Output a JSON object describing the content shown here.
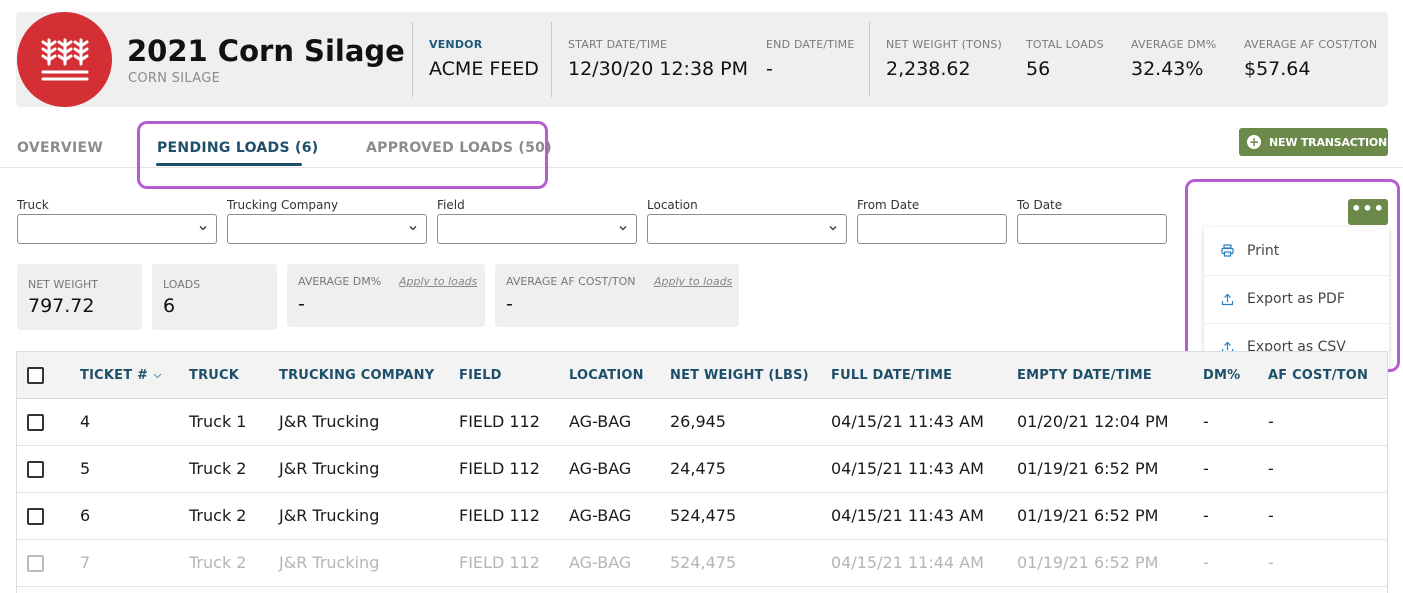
{
  "header": {
    "title": "2021 Corn Silage",
    "subtitle": "CORN SILAGE",
    "logo_icon": "wheat-icon",
    "brand_color": "#d32f34",
    "stats": {
      "vendor": {
        "label": "VENDOR",
        "value": "ACME FEED"
      },
      "start": {
        "label": "START DATE/TIME",
        "value": "12/30/20 12:38 PM"
      },
      "end": {
        "label": "END DATE/TIME",
        "value": "-"
      },
      "net_weight": {
        "label": "NET WEIGHT (TONS)",
        "value": "2,238.62"
      },
      "total_loads": {
        "label": "TOTAL LOADS",
        "value": "56"
      },
      "avg_dm": {
        "label": "AVERAGE DM%",
        "value": "32.43%"
      },
      "avg_af_cost": {
        "label": "AVERAGE AF COST/TON",
        "value": "$57.64"
      }
    }
  },
  "tabs": {
    "overview": "OVERVIEW",
    "pending": "PENDING LOADS (6)",
    "approved": "APPROVED LOADS (50)",
    "active": "pending"
  },
  "actions": {
    "new_transaction": "NEW TRANSACTION",
    "more": "•••",
    "accent_color": "#6b8a4a"
  },
  "filters": {
    "truck": {
      "label": "Truck",
      "value": ""
    },
    "trucking_company": {
      "label": "Trucking Company",
      "value": ""
    },
    "field": {
      "label": "Field",
      "value": ""
    },
    "location": {
      "label": "Location",
      "value": ""
    },
    "from_date": {
      "label": "From Date",
      "value": ""
    },
    "to_date": {
      "label": "To Date",
      "value": ""
    }
  },
  "menu": {
    "print": "Print",
    "export_pdf": "Export as PDF",
    "export_csv": "Export as CSV"
  },
  "summary": {
    "net_weight": {
      "label": "NET WEIGHT",
      "value": "797.72"
    },
    "loads": {
      "label": "LOADS",
      "value": "6"
    },
    "avg_dm": {
      "label": "AVERAGE DM%",
      "value": "-",
      "apply": "Apply to loads"
    },
    "avg_af_cost": {
      "label": "AVERAGE AF COST/TON",
      "value": "-",
      "apply": "Apply to loads"
    }
  },
  "table": {
    "columns": {
      "ticket": "TICKET #",
      "truck": "TRUCK",
      "company": "TRUCKING COMPANY",
      "field": "FIELD",
      "location": "LOCATION",
      "net_weight": "NET WEIGHT (LBS)",
      "full_date": "FULL DATE/TIME",
      "empty_date": "EMPTY DATE/TIME",
      "dm": "DM%",
      "af_cost": "AF COST/TON"
    },
    "rows": [
      {
        "ticket": "4",
        "truck": "Truck 1",
        "company": "J&R Trucking",
        "field": "FIELD 112",
        "location": "AG-BAG",
        "net_weight": "26,945",
        "full_date": "04/15/21 11:43 AM",
        "empty_date": "01/20/21 12:04 PM",
        "dm": "-",
        "af_cost": "-"
      },
      {
        "ticket": "5",
        "truck": "Truck 2",
        "company": "J&R Trucking",
        "field": "FIELD 112",
        "location": "AG-BAG",
        "net_weight": "24,475",
        "full_date": "04/15/21 11:43 AM",
        "empty_date": "01/19/21 6:52 PM",
        "dm": "-",
        "af_cost": "-"
      },
      {
        "ticket": "6",
        "truck": "Truck 2",
        "company": "J&R Trucking",
        "field": "FIELD 112",
        "location": "AG-BAG",
        "net_weight": "524,475",
        "full_date": "04/15/21 11:43 AM",
        "empty_date": "01/19/21 6:52 PM",
        "dm": "-",
        "af_cost": "-"
      },
      {
        "ticket": "7",
        "truck": "Truck 2",
        "company": "J&R Trucking",
        "field": "FIELD 112",
        "location": "AG-BAG",
        "net_weight": "524,475",
        "full_date": "04/15/21 11:44 AM",
        "empty_date": "01/19/21 6:52 PM",
        "dm": "-",
        "af_cost": "-"
      }
    ]
  }
}
